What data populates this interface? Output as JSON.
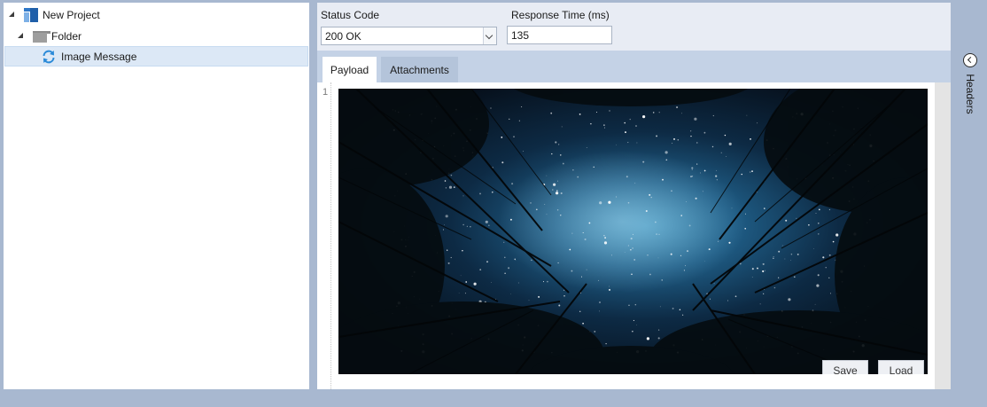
{
  "tree": {
    "items": [
      {
        "label": "New Project",
        "icon": "project-icon",
        "expanded": true,
        "selected": false
      },
      {
        "label": "Folder",
        "icon": "folder-icon",
        "expanded": true,
        "selected": false
      },
      {
        "label": "Image Message",
        "icon": "refresh-icon",
        "selected": true
      }
    ]
  },
  "form": {
    "status_code_label": "Status Code",
    "status_code_value": "200 OK",
    "response_time_label": "Response Time (ms)",
    "response_time_value": "135"
  },
  "tabs": [
    {
      "label": "Payload",
      "active": true
    },
    {
      "label": "Attachments",
      "active": false
    }
  ],
  "editor": {
    "line_number": "1",
    "save_label": "Save",
    "load_label": "Load"
  },
  "side_panel": {
    "label": "Headers",
    "icon": "chevron-left-icon"
  },
  "colors": {
    "background": "#a8b8d0",
    "selection": "#dce8f6",
    "tab_bar": "#c4d2e6",
    "accent": "#2f78c8"
  }
}
